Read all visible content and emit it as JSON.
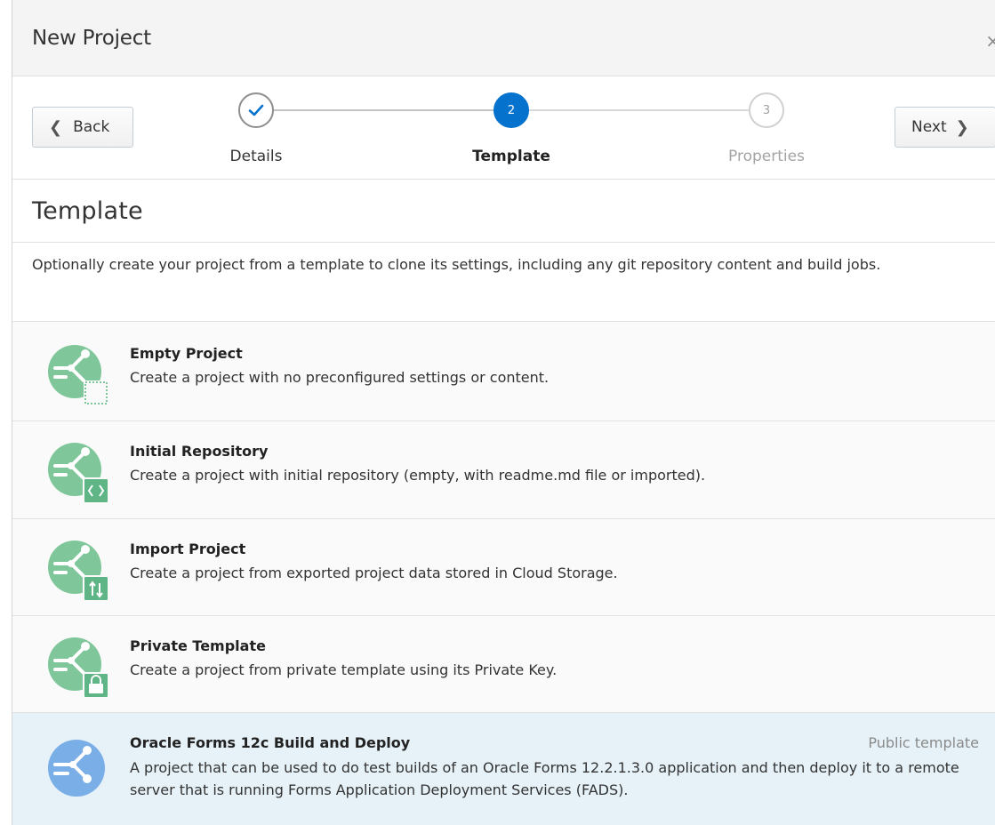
{
  "dialog": {
    "title": "New Project",
    "close_glyph": "×"
  },
  "train": {
    "back_label": "Back",
    "next_label": "Next",
    "steps": [
      {
        "label": "Details",
        "state": "completed",
        "glyph": ""
      },
      {
        "label": "Template",
        "state": "current",
        "glyph": "2"
      },
      {
        "label": "Properties",
        "state": "future",
        "glyph": "3"
      }
    ]
  },
  "section": {
    "title": "Template",
    "description": "Optionally create your project from a template to clone its settings, including any git repository content and build jobs."
  },
  "templates": [
    {
      "name": "Empty Project",
      "description": "Create a project with no preconfigured settings or content.",
      "badge": "",
      "icon": "empty-project-icon",
      "selected": false
    },
    {
      "name": "Initial Repository",
      "description": "Create a project with initial repository (empty, with readme.md file or imported).",
      "badge": "",
      "icon": "initial-repository-icon",
      "selected": false
    },
    {
      "name": "Import Project",
      "description": "Create a project from exported project data stored in Cloud Storage.",
      "badge": "",
      "icon": "import-project-icon",
      "selected": false
    },
    {
      "name": "Private Template",
      "description": "Create a project from private template using its Private Key.",
      "badge": "",
      "icon": "private-template-icon",
      "selected": false
    },
    {
      "name": "Oracle Forms 12c Build and Deploy",
      "description": "A project that can be used to do test builds of an Oracle Forms 12.2.1.3.0 application and then deploy it to a remote server that is running Forms Application Deployment Services (FADS).",
      "badge": "Public template",
      "icon": "public-template-icon",
      "selected": true
    }
  ],
  "colors": {
    "accent": "#0572ce",
    "green_icon": "#7fc79a",
    "blue_icon": "#7aaee6",
    "selected_row": "#e6f2f8"
  }
}
